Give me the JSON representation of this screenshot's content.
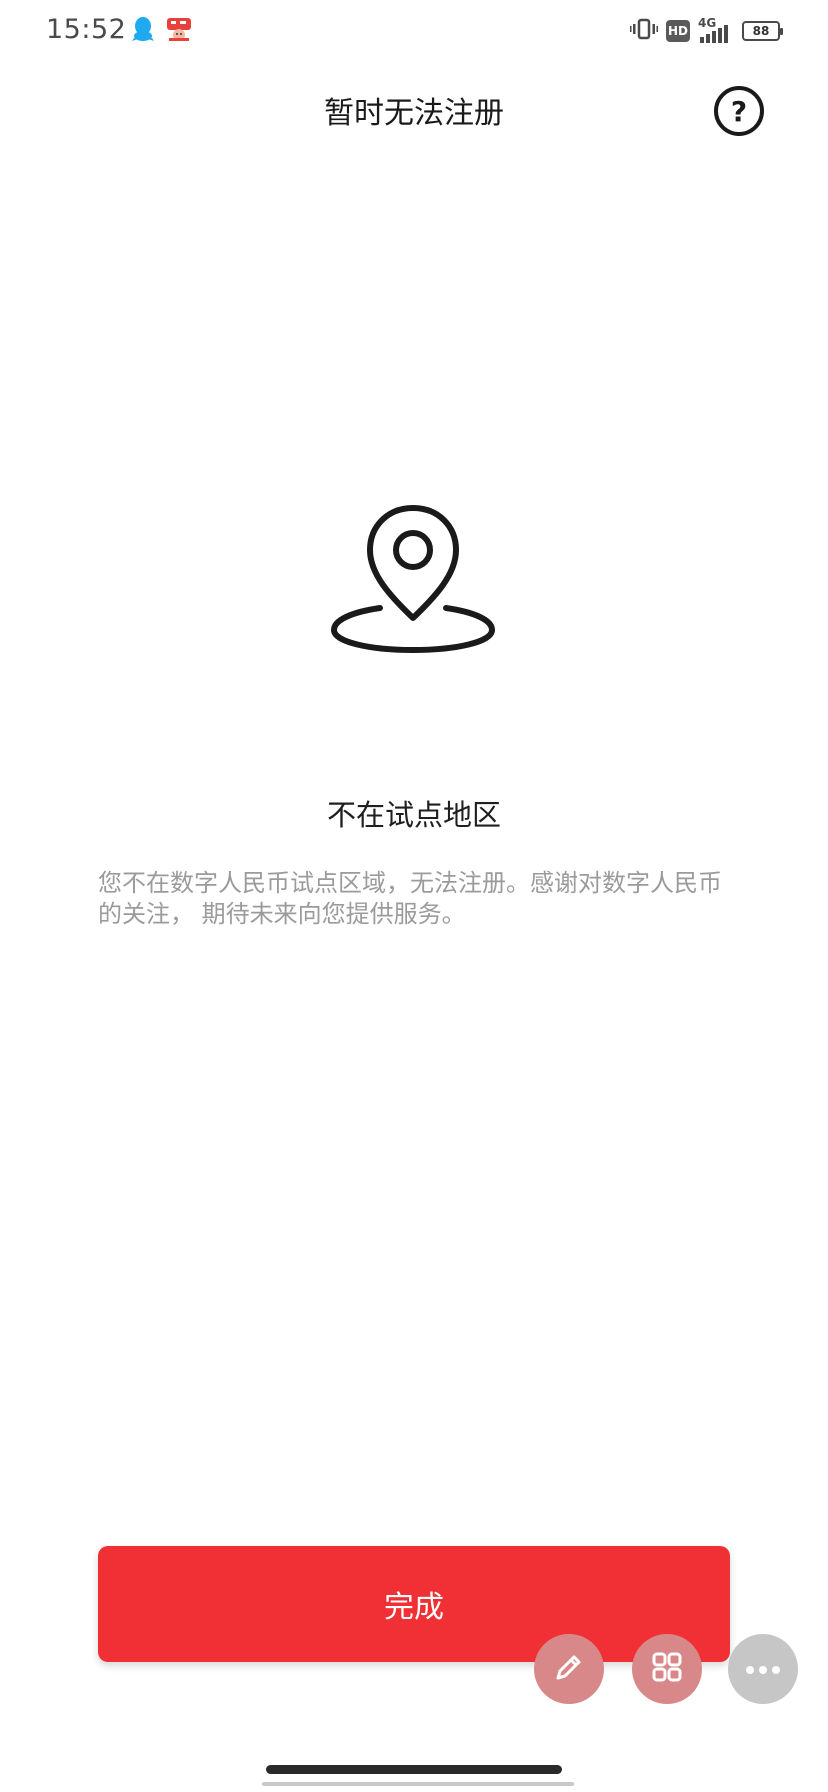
{
  "status_bar": {
    "time": "15:52",
    "network": "4G",
    "hd_label": "HD",
    "battery_level": "88",
    "icons": [
      "qq-icon",
      "app-notification-icon",
      "vibrate-icon",
      "hd-icon",
      "signal-icon",
      "battery-icon"
    ]
  },
  "header": {
    "title": "暂时无法注册",
    "help_label": "?"
  },
  "main": {
    "icon": "location-pin-icon",
    "title": "不在试点地区",
    "description": "您不在数字人民币试点区域，无法注册。感谢对数字人民币的关注， 期待未来向您提供服务。"
  },
  "actions": {
    "done_label": "完成"
  },
  "floating": {
    "icons": [
      "edit-icon",
      "grid-icon",
      "more-icon"
    ]
  },
  "colors": {
    "accent": "#f03034",
    "fab_accent": "#d9888a",
    "fab_neutral": "#c6c6c6",
    "text_primary": "#1f1f1f",
    "text_secondary": "#9b9b9b"
  }
}
